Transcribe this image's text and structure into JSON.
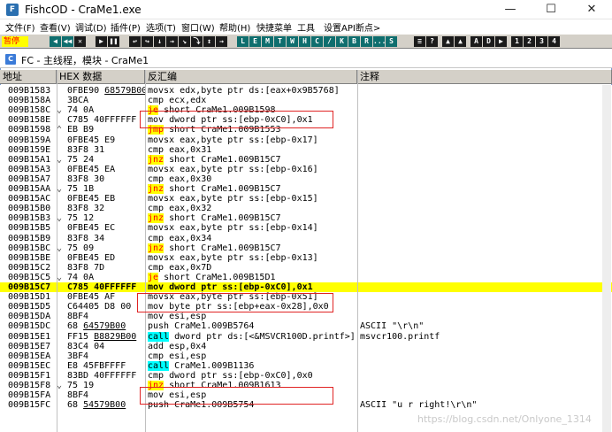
{
  "window": {
    "title": "FishcOD - CraMe1.exe",
    "app_icon_letter": "F",
    "minimize": "—",
    "maximize": "☐",
    "close": "✕"
  },
  "menu": [
    "文件(F)",
    "查看(V)",
    "调试(D)",
    "插件(P)",
    "选项(T)",
    "窗口(W)",
    "帮助(H)",
    "快捷菜单",
    "工具",
    "设置API断点>"
  ],
  "toolbar": {
    "status": "暂停",
    "left_buttons": [
      "◀",
      "◀◀",
      "✕",
      "▶",
      "❚❚",
      "↩",
      "↪",
      "↓",
      "→",
      "↘",
      "⤵",
      "↕",
      "→"
    ],
    "letter_buttons": [
      "L",
      "E",
      "M",
      "T",
      "W",
      "H",
      "C",
      "/",
      "K",
      "B",
      "R",
      "...",
      "S"
    ],
    "right_buttons": [
      "≡",
      "?",
      "▲",
      "▲",
      "A",
      "D",
      "▶",
      "1",
      "2",
      "3",
      "4"
    ]
  },
  "child_window": {
    "icon_letter": "C",
    "title": "FC - 主线程，模块 - CraMe1"
  },
  "columns": [
    "地址",
    "HEX 数据",
    "反汇编",
    "注释"
  ],
  "rows": [
    {
      "addr": "009B1583",
      "gap": "",
      "hex": "0FBE90 68579B00",
      "hex_link": "68579B00",
      "kw": "",
      "dis": "movsx edx,byte ptr ds:[eax+0x9B5768]",
      "comment": ""
    },
    {
      "addr": "009B158A",
      "gap": "",
      "hex": "3BCA",
      "kw": "",
      "dis": "cmp ecx,edx",
      "comment": ""
    },
    {
      "addr": "009B158C",
      "gap": "⌄",
      "hex": "74 0A",
      "kw": "je",
      "dis": " short CraMe1.009B1598",
      "comment": ""
    },
    {
      "addr": "009B158E",
      "gap": "",
      "hex": "C785 40FFFFFF",
      "kw": "",
      "dis": "mov dword ptr ss:[ebp-0xC0],0x1",
      "comment": ""
    },
    {
      "addr": "009B1598",
      "gap": "⌃",
      "hex": "EB B9",
      "kw": "jmp",
      "dis": " short CraMe1.009B1553",
      "comment": ""
    },
    {
      "addr": "009B159A",
      "gap": "",
      "hex": "0FBE45 E9",
      "kw": "",
      "dis": "movsx eax,byte ptr ss:[ebp-0x17]",
      "comment": ""
    },
    {
      "addr": "009B159E",
      "gap": "",
      "hex": "83F8 31",
      "kw": "",
      "dis": "cmp eax,0x31",
      "comment": ""
    },
    {
      "addr": "009B15A1",
      "gap": "⌄",
      "hex": "75 24",
      "kw": "jnz",
      "dis": " short CraMe1.009B15C7",
      "comment": ""
    },
    {
      "addr": "009B15A3",
      "gap": "",
      "hex": "0FBE45 EA",
      "kw": "",
      "dis": "movsx eax,byte ptr ss:[ebp-0x16]",
      "comment": ""
    },
    {
      "addr": "009B15A7",
      "gap": "",
      "hex": "83F8 30",
      "kw": "",
      "dis": "cmp eax,0x30",
      "comment": ""
    },
    {
      "addr": "009B15AA",
      "gap": "⌄",
      "hex": "75 1B",
      "kw": "jnz",
      "dis": " short CraMe1.009B15C7",
      "comment": ""
    },
    {
      "addr": "009B15AC",
      "gap": "",
      "hex": "0FBE45 EB",
      "kw": "",
      "dis": "movsx eax,byte ptr ss:[ebp-0x15]",
      "comment": ""
    },
    {
      "addr": "009B15B0",
      "gap": "",
      "hex": "83F8 32",
      "kw": "",
      "dis": "cmp eax,0x32",
      "comment": ""
    },
    {
      "addr": "009B15B3",
      "gap": "⌄",
      "hex": "75 12",
      "kw": "jnz",
      "dis": " short CraMe1.009B15C7",
      "comment": ""
    },
    {
      "addr": "009B15B5",
      "gap": "",
      "hex": "0FBE45 EC",
      "kw": "",
      "dis": "movsx eax,byte ptr ss:[ebp-0x14]",
      "comment": ""
    },
    {
      "addr": "009B15B9",
      "gap": "",
      "hex": "83F8 34",
      "kw": "",
      "dis": "cmp eax,0x34",
      "comment": ""
    },
    {
      "addr": "009B15BC",
      "gap": "⌄",
      "hex": "75 09",
      "kw": "jnz",
      "dis": " short CraMe1.009B15C7",
      "comment": ""
    },
    {
      "addr": "009B15BE",
      "gap": "",
      "hex": "0FBE45 ED",
      "kw": "",
      "dis": "movsx eax,byte ptr ss:[ebp-0x13]",
      "comment": ""
    },
    {
      "addr": "009B15C2",
      "gap": "",
      "hex": "83F8 7D",
      "kw": "",
      "dis": "cmp eax,0x7D",
      "comment": ""
    },
    {
      "addr": "009B15C5",
      "gap": "⌄",
      "hex": "74 0A",
      "kw": "je",
      "dis": " short CraMe1.009B15D1",
      "comment": ""
    },
    {
      "addr": "009B15C7",
      "gap": "",
      "hex": "C785 40FFFFFF",
      "kw": "",
      "dis": "mov dword ptr ss:[ebp-0xC0],0x1",
      "comment": "",
      "current": true
    },
    {
      "addr": "009B15D1",
      "gap": "",
      "hex": "0FBE45 AF",
      "kw": "",
      "dis": "movsx eax,byte ptr ss:[ebp-0x51]",
      "comment": ""
    },
    {
      "addr": "009B15D5",
      "gap": "",
      "hex": "C64405 D8 00",
      "kw": "",
      "dis": "mov byte ptr ss:[ebp+eax-0x28],0x0",
      "comment": ""
    },
    {
      "addr": "009B15DA",
      "gap": "",
      "hex": "8BF4",
      "kw": "",
      "dis": "mov esi,esp",
      "comment": ""
    },
    {
      "addr": "009B15DC",
      "gap": "",
      "hex": "68 64579B00",
      "hex_link": "64579B00",
      "kw": "",
      "dis": "push CraMe1.009B5764",
      "comment": "ASCII \"\\r\\n\""
    },
    {
      "addr": "009B15E1",
      "gap": "",
      "hex": "FF15 B8829B00",
      "hex_link": "B8829B00",
      "kw": "call",
      "dis": " dword ptr ds:[<&MSVCR100D.printf>]",
      "comment": "msvcr100.printf"
    },
    {
      "addr": "009B15E7",
      "gap": "",
      "hex": "83C4 04",
      "kw": "",
      "dis": "add esp,0x4",
      "comment": ""
    },
    {
      "addr": "009B15EA",
      "gap": "",
      "hex": "3BF4",
      "kw": "",
      "dis": "cmp esi,esp",
      "comment": ""
    },
    {
      "addr": "009B15EC",
      "gap": "",
      "hex": "E8 45FBFFFF",
      "kw": "call",
      "dis": " CraMe1.009B1136",
      "comment": ""
    },
    {
      "addr": "009B15F1",
      "gap": "",
      "hex": "83BD 40FFFFFF",
      "kw": "",
      "dis": "cmp dword ptr ss:[ebp-0xC0],0x0",
      "comment": ""
    },
    {
      "addr": "009B15F8",
      "gap": "⌄",
      "hex": "75 19",
      "kw": "jnz",
      "dis": " short CraMe1.009B1613",
      "comment": ""
    },
    {
      "addr": "009B15FA",
      "gap": "",
      "hex": "8BF4",
      "kw": "",
      "dis": "mov esi,esp",
      "comment": ""
    },
    {
      "addr": "009B15FC",
      "gap": "",
      "hex": "68 54579B00",
      "hex_link": "54579B00",
      "kw": "",
      "dis": "push CraMe1.009B5754",
      "comment": "ASCII \"u r right!\\r\\n\""
    }
  ],
  "watermark": "https://blog.csdn.net/Onlyone_1314",
  "colors": {
    "current_line": "#ffff00",
    "jump_highlight": "#ffff00",
    "jump_text": "#ff0000",
    "call_highlight": "#00ffff",
    "annotation_box": "#e02424",
    "toolbar_bg": "#d4d0c8"
  }
}
